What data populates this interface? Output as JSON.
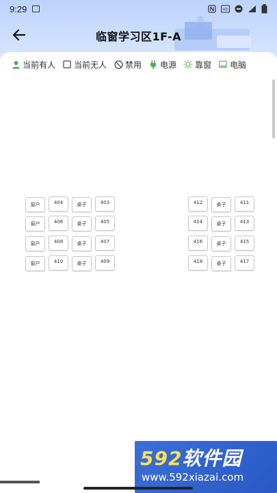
{
  "status_bar": {
    "time": "9:29"
  },
  "nav": {
    "title": "临窗学习区1F-A"
  },
  "legend": [
    {
      "icon": "person-icon",
      "label": "当前有人",
      "color": "#4caf50"
    },
    {
      "icon": "empty-square-icon",
      "label": "当前无人",
      "color": "#444444"
    },
    {
      "icon": "ban-icon",
      "label": "禁用",
      "color": "#444444"
    },
    {
      "icon": "plug-icon",
      "label": "电源",
      "color": "#4caf50"
    },
    {
      "icon": "sun-icon",
      "label": "靠窗",
      "color": "#4caf50"
    },
    {
      "icon": "laptop-icon",
      "label": "电脑",
      "color": "#4caf50"
    }
  ],
  "seats_left": [
    [
      "窗户",
      "404",
      "桌子",
      "403"
    ],
    [
      "窗户",
      "406",
      "桌子",
      "405"
    ],
    [
      "窗户",
      "408",
      "桌子",
      "407"
    ],
    [
      "窗户",
      "410",
      "桌子",
      "409"
    ]
  ],
  "seats_right": [
    [
      "412",
      "桌子",
      "411"
    ],
    [
      "414",
      "桌子",
      "413"
    ],
    [
      "416",
      "桌子",
      "415"
    ],
    [
      "418",
      "桌子",
      "417"
    ]
  ],
  "watermark": {
    "brand_prefix": "592",
    "brand_suffix": "软件园",
    "url": "www.592xiazai.com"
  }
}
